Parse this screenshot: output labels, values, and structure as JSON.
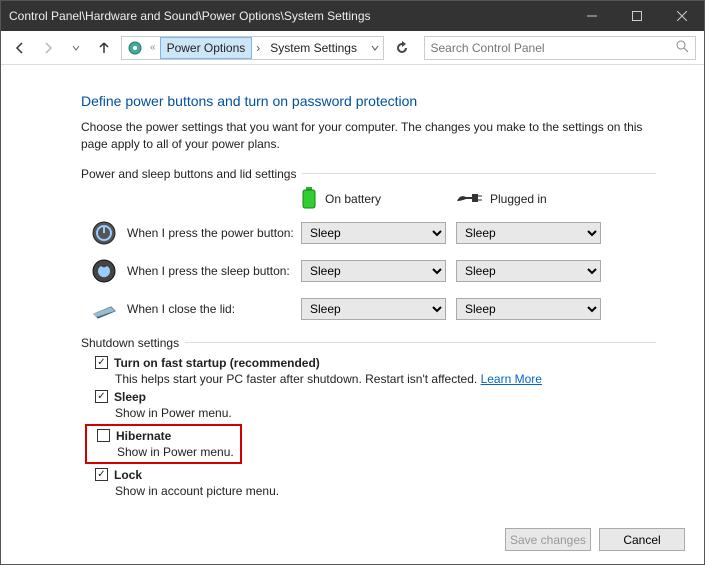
{
  "title": "Control Panel\\Hardware and Sound\\Power Options\\System Settings",
  "breadcrumb": {
    "parent": "Power Options",
    "current": "System Settings",
    "prefix": "«"
  },
  "search": {
    "placeholder": "Search Control Panel"
  },
  "heading": "Define power buttons and turn on password protection",
  "desc": "Choose the power settings that you want for your computer. The changes you make to the settings on this page apply to all of your power plans.",
  "section1": "Power and sleep buttons and lid settings",
  "cols": {
    "battery": "On battery",
    "plugged": "Plugged in"
  },
  "rows": {
    "power": {
      "label": "When I press the power button:",
      "battery": "Sleep",
      "plugged": "Sleep"
    },
    "sleep": {
      "label": "When I press the sleep button:",
      "battery": "Sleep",
      "plugged": "Sleep"
    },
    "lid": {
      "label": "When I close the lid:",
      "battery": "Sleep",
      "plugged": "Sleep"
    }
  },
  "shutdown": {
    "title": "Shutdown settings",
    "fast": {
      "label": "Turn on fast startup (recommended)",
      "sub": "This helps start your PC faster after shutdown. Restart isn't affected.",
      "learn": "Learn More",
      "checked": true
    },
    "sleep": {
      "label": "Sleep",
      "sub": "Show in Power menu.",
      "checked": true
    },
    "hib": {
      "label": "Hibernate",
      "sub": "Show in Power menu.",
      "checked": false
    },
    "lock": {
      "label": "Lock",
      "sub": "Show in account picture menu.",
      "checked": true
    }
  },
  "buttons": {
    "save": "Save changes",
    "cancel": "Cancel"
  }
}
